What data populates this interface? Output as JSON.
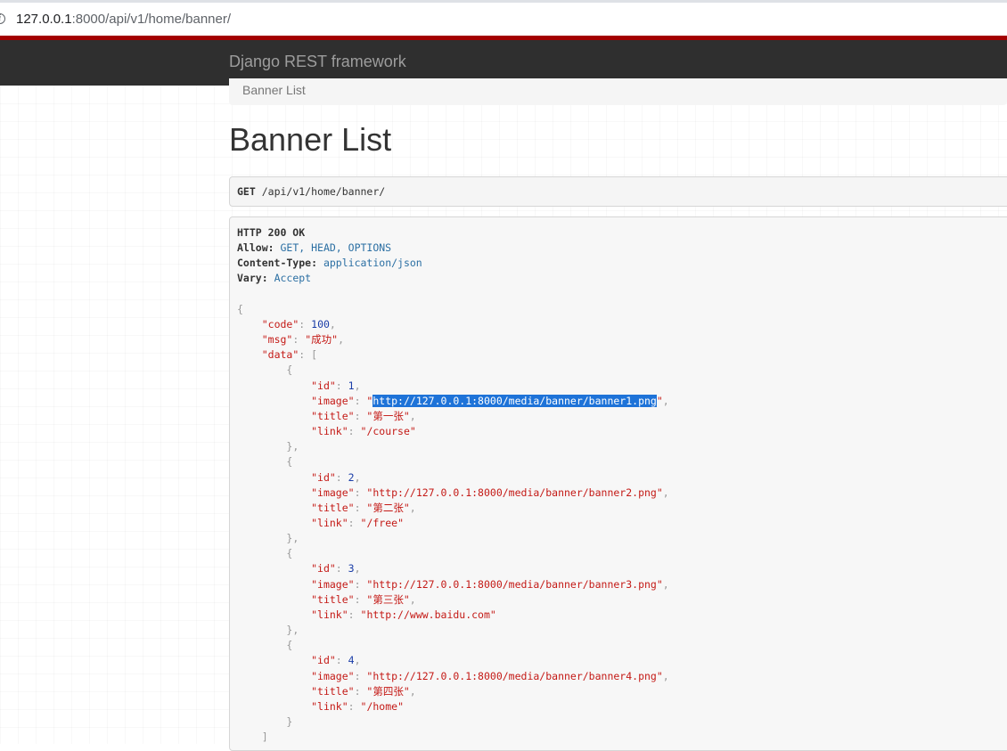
{
  "browser": {
    "url_host": "127.0.0.1",
    "url_rest": ":8000/api/v1/home/banner/"
  },
  "navbar": {
    "brand": "Django REST framework"
  },
  "breadcrumb": {
    "item": "Banner List"
  },
  "page": {
    "title": "Banner List"
  },
  "request": {
    "method": "GET",
    "path": "/api/v1/home/banner/"
  },
  "response": {
    "status": "HTTP 200 OK",
    "headers": [
      {
        "name": "Allow:",
        "value": "GET, HEAD, OPTIONS"
      },
      {
        "name": "Content-Type:",
        "value": "application/json"
      },
      {
        "name": "Vary:",
        "value": "Accept"
      }
    ],
    "body": {
      "code_key": "code",
      "code": "100",
      "msg_key": "msg",
      "msg": "成功",
      "data_key": "data",
      "items": [
        {
          "id": "1",
          "image": "http://127.0.0.1:8000/media/banner/banner1.png",
          "title": "第一张",
          "link": "/course"
        },
        {
          "id": "2",
          "image": "http://127.0.0.1:8000/media/banner/banner2.png",
          "title": "第二张",
          "link": "/free"
        },
        {
          "id": "3",
          "image": "http://127.0.0.1:8000/media/banner/banner3.png",
          "title": "第三张",
          "link": "http://www.baidu.com"
        },
        {
          "id": "4",
          "image": "http://127.0.0.1:8000/media/banner/banner4.png",
          "title": "第四张",
          "link": "/home"
        }
      ],
      "selected_text": "http://127.0.0.1:8000/media/banner/banner1.png"
    }
  },
  "colors": {
    "navbar_bg": "#2f2f2f",
    "accent_stripe": "#a30000",
    "json_string": "#c41a16",
    "json_number": "#1a3da8",
    "selection": "#1e73d8"
  }
}
